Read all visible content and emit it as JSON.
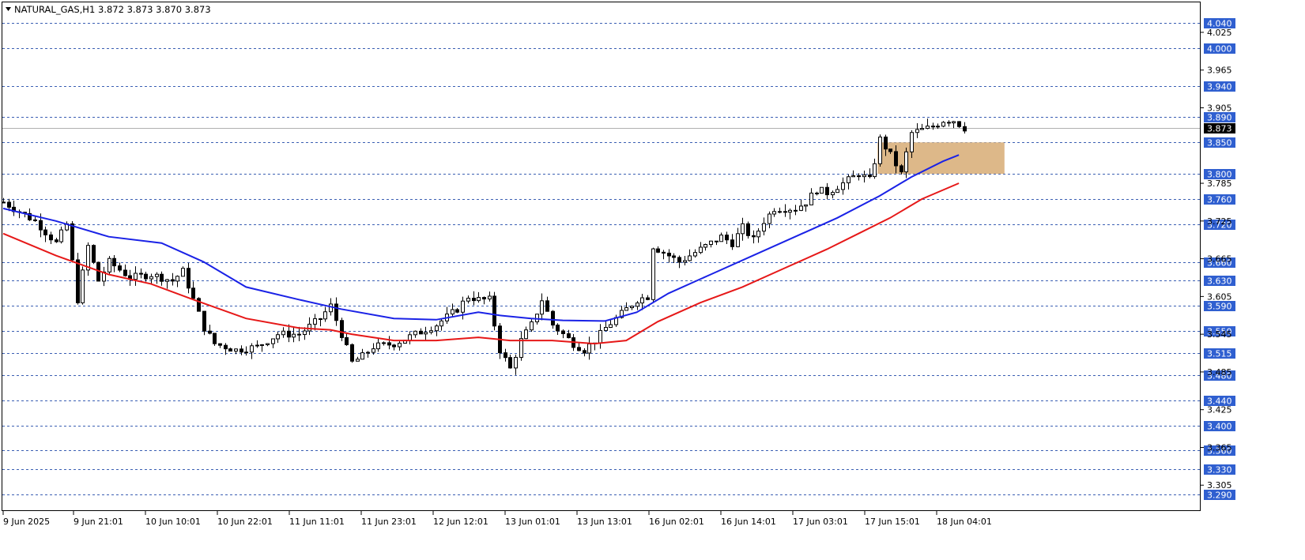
{
  "header": {
    "symbol": "NATURAL_GAS,H1",
    "quote": "3.872 3.873 3.870 3.873"
  },
  "colors": {
    "background": "#ffffff",
    "grid": "#3b5fb3",
    "label_bg": "#2f5fd0",
    "label_text": "#ffffff",
    "candle": "#000000",
    "ma_fast": "#1a22e6",
    "ma_slow": "#e61818",
    "zone": "#ddb889",
    "current_price_bg": "#000000"
  },
  "chart_data": {
    "type": "candlestick",
    "ylim": [
      3.29,
      4.06
    ],
    "price_scale_ticks": [
      "4.025",
      "3.965",
      "3.905",
      "3.785",
      "3.725",
      "3.665",
      "3.605",
      "3.545",
      "3.485",
      "3.425",
      "3.365",
      "3.305"
    ],
    "level_lines": [
      "4.040",
      "4.000",
      "3.940",
      "3.890",
      "3.850",
      "3.800",
      "3.760",
      "3.720",
      "3.660",
      "3.630",
      "3.590",
      "3.550",
      "3.515",
      "3.480",
      "3.440",
      "3.400",
      "3.360",
      "3.330",
      "3.290"
    ],
    "current_price": "3.873",
    "time_labels": [
      "9 Jun 2025",
      "9 Jun 21:01",
      "10 Jun 10:01",
      "10 Jun 22:01",
      "11 Jun 11:01",
      "11 Jun 23:01",
      "12 Jun 12:01",
      "13 Jun 01:01",
      "13 Jun 13:01",
      "16 Jun 02:01",
      "16 Jun 14:01",
      "17 Jun 03:01",
      "17 Jun 15:01",
      "18 Jun 04:01"
    ],
    "close_path": [
      [
        0,
        3.755
      ],
      [
        6,
        3.725
      ],
      [
        10,
        3.69
      ],
      [
        12,
        3.72
      ],
      [
        14,
        3.6
      ],
      [
        16,
        3.685
      ],
      [
        18,
        3.63
      ],
      [
        20,
        3.66
      ],
      [
        24,
        3.635
      ],
      [
        28,
        3.64
      ],
      [
        32,
        3.63
      ],
      [
        34,
        3.645
      ],
      [
        36,
        3.6
      ],
      [
        38,
        3.555
      ],
      [
        40,
        3.53
      ],
      [
        44,
        3.52
      ],
      [
        48,
        3.525
      ],
      [
        52,
        3.545
      ],
      [
        56,
        3.545
      ],
      [
        60,
        3.57
      ],
      [
        62,
        3.59
      ],
      [
        64,
        3.545
      ],
      [
        66,
        3.5
      ],
      [
        68,
        3.51
      ],
      [
        70,
        3.525
      ],
      [
        74,
        3.53
      ],
      [
        78,
        3.545
      ],
      [
        82,
        3.56
      ],
      [
        86,
        3.585
      ],
      [
        88,
        3.605
      ],
      [
        90,
        3.6
      ],
      [
        92,
        3.6
      ],
      [
        94,
        3.52
      ],
      [
        96,
        3.49
      ],
      [
        98,
        3.535
      ],
      [
        100,
        3.56
      ],
      [
        102,
        3.6
      ],
      [
        104,
        3.56
      ],
      [
        106,
        3.545
      ],
      [
        108,
        3.53
      ],
      [
        110,
        3.52
      ],
      [
        112,
        3.535
      ],
      [
        114,
        3.555
      ],
      [
        116,
        3.57
      ],
      [
        118,
        3.585
      ],
      [
        120,
        3.6
      ],
      [
        122,
        3.605
      ],
      [
        123,
        3.685
      ],
      [
        125,
        3.675
      ],
      [
        128,
        3.66
      ],
      [
        131,
        3.675
      ],
      [
        134,
        3.69
      ],
      [
        136,
        3.7
      ],
      [
        138,
        3.69
      ],
      [
        140,
        3.715
      ],
      [
        142,
        3.695
      ],
      [
        144,
        3.725
      ],
      [
        146,
        3.745
      ],
      [
        148,
        3.745
      ],
      [
        150,
        3.745
      ],
      [
        152,
        3.755
      ],
      [
        154,
        3.775
      ],
      [
        156,
        3.77
      ],
      [
        158,
        3.78
      ],
      [
        160,
        3.79
      ],
      [
        162,
        3.8
      ],
      [
        164,
        3.79
      ],
      [
        165,
        3.82
      ],
      [
        166,
        3.855
      ],
      [
        168,
        3.83
      ],
      [
        170,
        3.8
      ],
      [
        172,
        3.865
      ],
      [
        174,
        3.87
      ],
      [
        176,
        3.875
      ],
      [
        178,
        3.885
      ],
      [
        180,
        3.885
      ],
      [
        182,
        3.873
      ]
    ],
    "series": [
      {
        "points": [
          [
            0,
            3.745
          ],
          [
            10,
            3.725
          ],
          [
            20,
            3.7
          ],
          [
            30,
            3.69
          ],
          [
            38,
            3.66
          ],
          [
            46,
            3.62
          ],
          [
            56,
            3.6
          ],
          [
            64,
            3.585
          ],
          [
            74,
            3.57
          ],
          [
            82,
            3.568
          ],
          [
            90,
            3.58
          ],
          [
            94,
            3.575
          ],
          [
            100,
            3.57
          ],
          [
            106,
            3.567
          ],
          [
            114,
            3.566
          ],
          [
            120,
            3.58
          ],
          [
            126,
            3.61
          ],
          [
            134,
            3.64
          ],
          [
            142,
            3.67
          ],
          [
            150,
            3.7
          ],
          [
            158,
            3.73
          ],
          [
            166,
            3.765
          ],
          [
            172,
            3.795
          ],
          [
            178,
            3.82
          ],
          [
            181,
            3.83
          ]
        ]
      },
      {
        "points": [
          [
            0,
            3.705
          ],
          [
            10,
            3.67
          ],
          [
            20,
            3.64
          ],
          [
            28,
            3.625
          ],
          [
            36,
            3.6
          ],
          [
            46,
            3.57
          ],
          [
            56,
            3.555
          ],
          [
            62,
            3.552
          ],
          [
            66,
            3.545
          ],
          [
            74,
            3.535
          ],
          [
            82,
            3.535
          ],
          [
            90,
            3.54
          ],
          [
            96,
            3.535
          ],
          [
            104,
            3.535
          ],
          [
            112,
            3.53
          ],
          [
            118,
            3.535
          ],
          [
            124,
            3.565
          ],
          [
            132,
            3.595
          ],
          [
            140,
            3.62
          ],
          [
            148,
            3.65
          ],
          [
            156,
            3.68
          ],
          [
            162,
            3.705
          ],
          [
            168,
            3.73
          ],
          [
            174,
            3.76
          ],
          [
            181,
            3.785
          ]
        ]
      }
    ],
    "zone": {
      "x": [
        165,
        185
      ],
      "y": [
        3.8,
        3.85
      ]
    }
  }
}
